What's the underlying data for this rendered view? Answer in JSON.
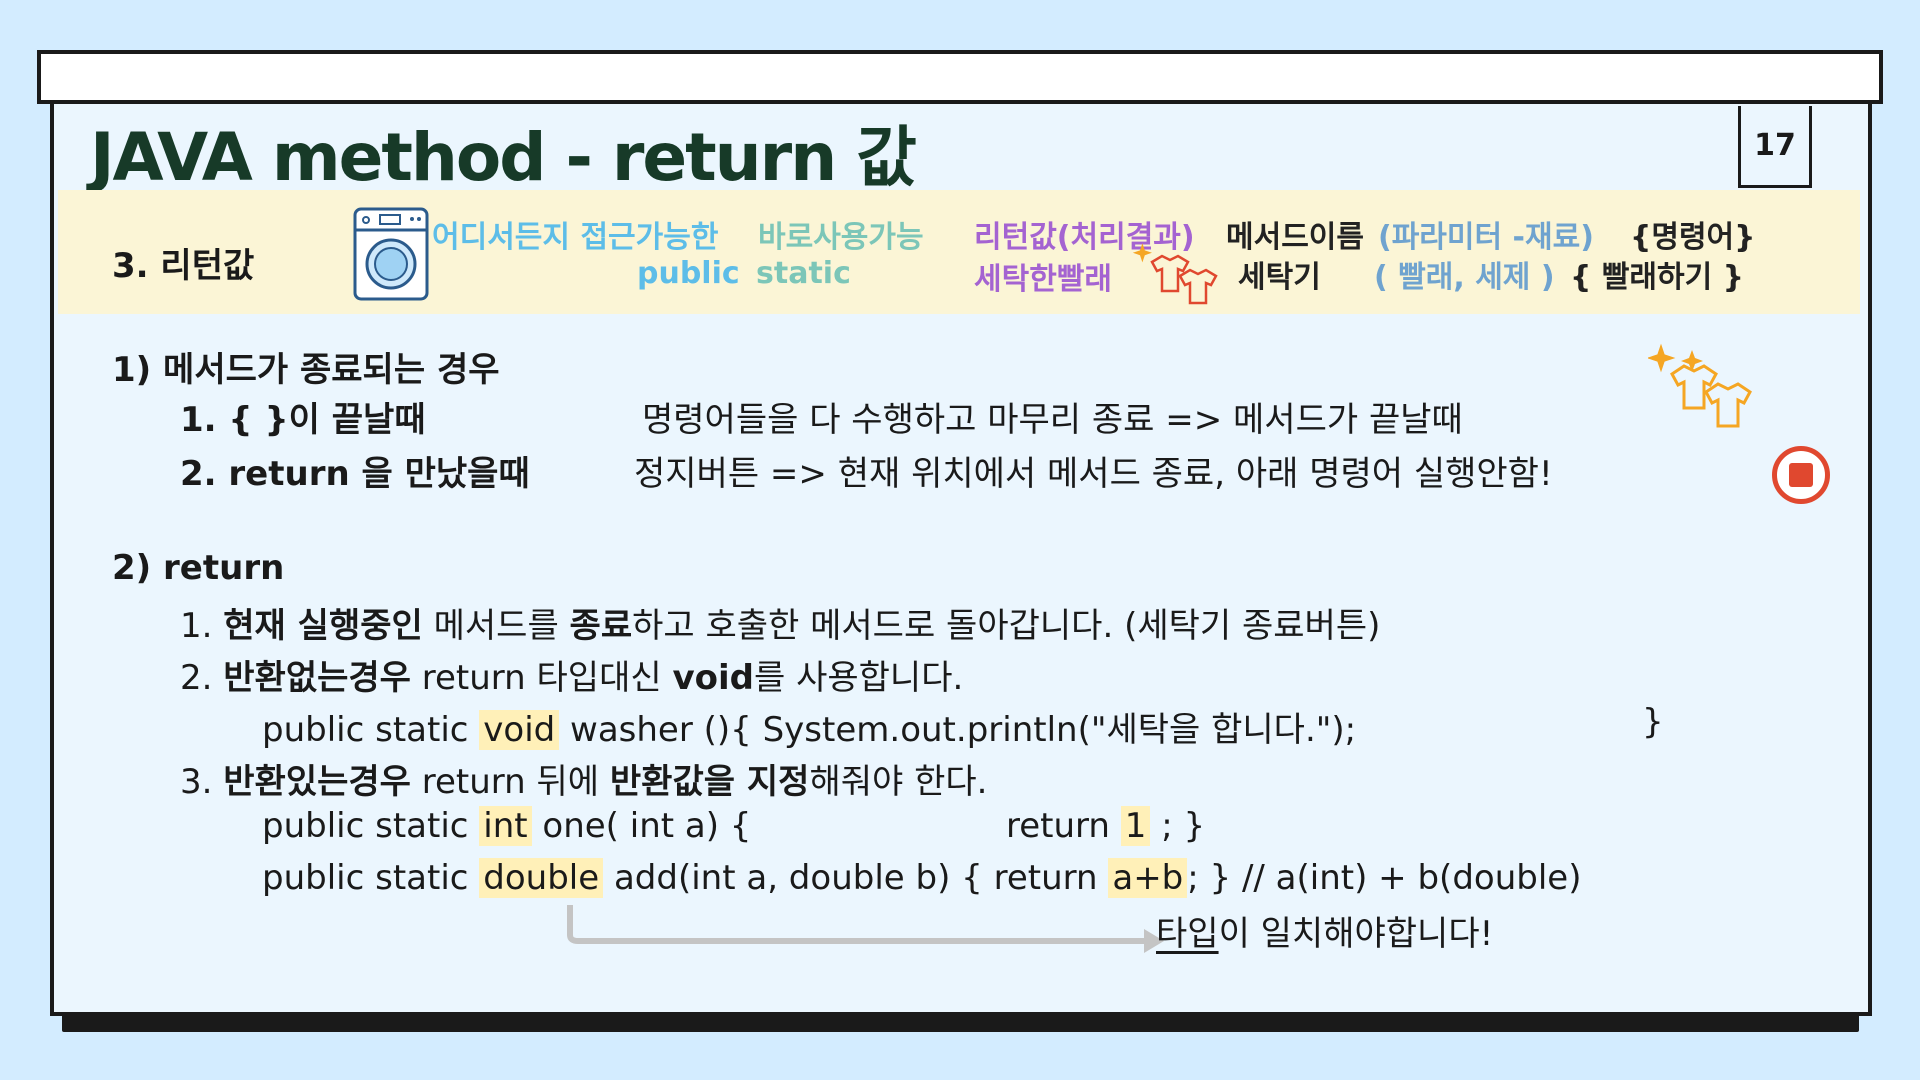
{
  "slide": {
    "title": "JAVA method - return 값",
    "page_number": "17"
  },
  "band": {
    "label": "3. 리턴값",
    "anywhere": "어디서든지 접근가능한",
    "direct": "바로사용가능",
    "public": "public",
    "static": "static",
    "return_value": "리턴값(처리결과)",
    "laundry": "세탁한빨래",
    "method_name": "메서드이름",
    "params": "(파라미터 -재료)",
    "commands": "{명령어}",
    "washer": "세탁기",
    "args": "( 빨래, 세제 )",
    "do_laundry": "{ 빨래하기 }"
  },
  "section1": {
    "heading": "1)  메서드가  종료되는 경우",
    "item1_label": "1. { }이 끝날때",
    "item1_desc": "명령어들을 다 수행하고 마무리 종료 => 메서드가 끝날때",
    "item2_label": "2. return 을 만났을때",
    "item2_desc": "정지버튼 => 현재 위치에서 메서드 종료, 아래 명령어 실행안함!"
  },
  "section2": {
    "heading": "2)  return",
    "l1_num": "1.",
    "l1_a": "현재 실행중인",
    "l1_b": " 메서드를 ",
    "l1_c": "종료",
    "l1_d": "하고 호출한 메서드로 돌아갑니다.  (세탁기 종료버튼)",
    "l2_num": "2.",
    "l2_a": "반환없는경우",
    "l2_b": " return 타입대신 ",
    "l2_c": "void",
    "l2_d": "를 사용합니다.",
    "code1_a": "public static ",
    "code1_void": "void",
    "code1_b": " washer (){ System.out.println(\"세탁을 합니다.\");",
    "code1_c": "}",
    "l3_num": "3.",
    "l3_a": "반환있는경우",
    "l3_b": " return 뒤에 ",
    "l3_c": "반환값을 지정",
    "l3_d": "해줘야 한다.",
    "code2_a": "public  static ",
    "code2_int": "int",
    "code2_b": " one( int a) {",
    "code2_ret": "return ",
    "code2_one": "1",
    "code2_c": " ;   }",
    "code3_a": "public  static ",
    "code3_double": "double",
    "code3_b": " add(int a, double b) { return ",
    "code3_ab": "a+b",
    "code3_c": "; }   // a(int) + b(double)",
    "note_a": "타입",
    "note_b": "이 일치해야합니다!"
  }
}
